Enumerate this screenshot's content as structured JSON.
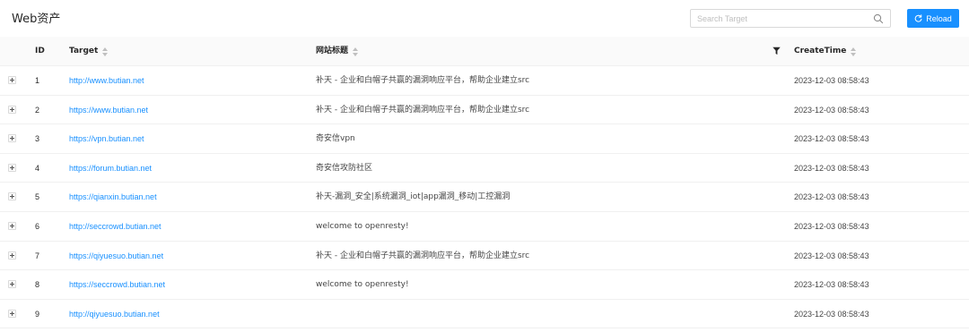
{
  "page": {
    "title": "Web资产"
  },
  "search": {
    "placeholder": "Search Target",
    "value": ""
  },
  "toolbar": {
    "reload_label": "Reload"
  },
  "colors": {
    "primary": "#1890ff",
    "header_bg": "#fafafa",
    "border": "#f0f0f0"
  },
  "table": {
    "columns": {
      "id": "ID",
      "target": "Target",
      "title": "网站标题",
      "create_time": "CreateTime"
    },
    "rows": [
      {
        "id": "1",
        "target": "http://www.butian.net",
        "title": "补天 - 企业和白帽子共赢的漏洞响应平台，帮助企业建立src",
        "create_time": "2023-12-03 08:58:43"
      },
      {
        "id": "2",
        "target": "https://www.butian.net",
        "title": "补天 - 企业和白帽子共赢的漏洞响应平台，帮助企业建立src",
        "create_time": "2023-12-03 08:58:43"
      },
      {
        "id": "3",
        "target": "https://vpn.butian.net",
        "title": "奇安信vpn",
        "create_time": "2023-12-03 08:58:43"
      },
      {
        "id": "4",
        "target": "https://forum.butian.net",
        "title": "奇安信攻防社区",
        "create_time": "2023-12-03 08:58:43"
      },
      {
        "id": "5",
        "target": "https://qianxin.butian.net",
        "title": "补天-漏洞_安全|系统漏洞_iot|app漏洞_移动|工控漏洞",
        "create_time": "2023-12-03 08:58:43"
      },
      {
        "id": "6",
        "target": "http://seccrowd.butian.net",
        "title": "welcome to openresty!",
        "create_time": "2023-12-03 08:58:43"
      },
      {
        "id": "7",
        "target": "https://qiyuesuo.butian.net",
        "title": "补天 - 企业和白帽子共赢的漏洞响应平台，帮助企业建立src",
        "create_time": "2023-12-03 08:58:43"
      },
      {
        "id": "8",
        "target": "https://seccrowd.butian.net",
        "title": "welcome to openresty!",
        "create_time": "2023-12-03 08:58:43"
      },
      {
        "id": "9",
        "target": "http://qiyuesuo.butian.net",
        "title": "",
        "create_time": "2023-12-03 08:58:43"
      }
    ]
  }
}
